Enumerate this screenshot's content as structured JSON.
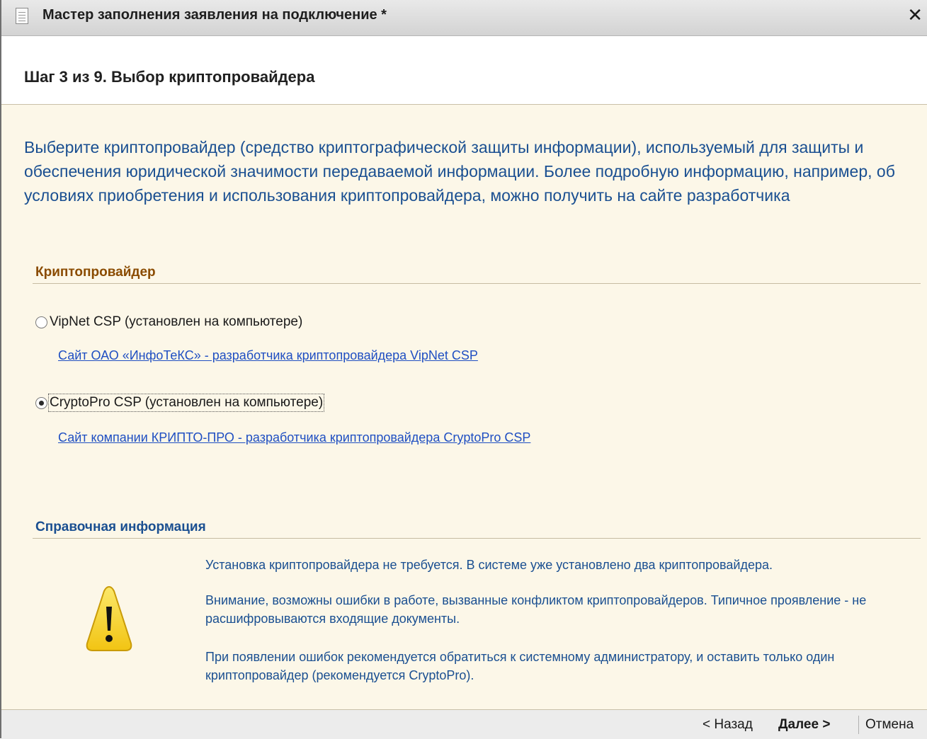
{
  "window": {
    "title": "Мастер заполнения заявления на подключение *",
    "close_label": "✕"
  },
  "header": {
    "step_title": "Шаг 3 из 9. Выбор криптопровайдера"
  },
  "intro": {
    "text": "Выберите криптопровайдер (средство криптографической защиты информации), используемый для защиты и обеспечения юридической значимости передаваемой информации. Более подробную информацию, например, об условиях приобретения и использования криптопровайдера, можно получить на сайте разработчика"
  },
  "crypto_section": {
    "label": "Криптопровайдер",
    "options": [
      {
        "label": "VipNet CSP (установлен на компьютере)",
        "selected": false,
        "link": "Сайт ОАО «ИнфоТеКС» - разработчика криптопровайдера VipNet CSP"
      },
      {
        "label": "CryptoPro CSP (установлен на компьютере)",
        "selected": true,
        "link": "Сайт компании КРИПТО-ПРО - разработчика криптопровайдера  CryptoPro CSP"
      }
    ]
  },
  "info_section": {
    "label": "Справочная информация",
    "messages": [
      "Установка криптопровайдера не требуется. В системе уже установлено два криптопровайдера.",
      "Внимание, возможны ошибки в работе, вызванные конфликтом криптопровайдеров. Типичное проявление - не расшифровываются входящие документы.",
      "При появлении ошибок рекомендуется обратиться к системному администратору, и оставить только один криптопровайдер (рекомендуется CryptoPro)."
    ]
  },
  "footer": {
    "back_label": "< Назад",
    "next_label": "Далее  >",
    "cancel_label": "Отмена"
  },
  "colors": {
    "accent_text": "#1a4f91",
    "link": "#1f4fc2",
    "section_crypto": "#8a4b00",
    "section_info": "#1a4f91",
    "warning_fill": "#f6d328"
  },
  "icons": {
    "title_icon": "document-icon",
    "warning_icon": "warning-triangle-icon"
  }
}
